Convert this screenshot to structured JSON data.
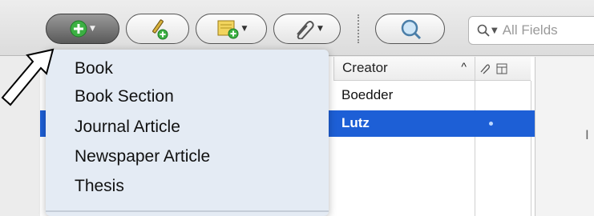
{
  "toolbar": {
    "buttons": [
      {
        "name": "new-item",
        "icon": "green-plus-icon"
      },
      {
        "name": "add-by-identifier",
        "icon": "magic-wand-icon"
      },
      {
        "name": "new-note",
        "icon": "note-icon"
      },
      {
        "name": "add-attachment",
        "icon": "paperclip-icon"
      },
      {
        "name": "advanced-search",
        "icon": "magnifier-icon"
      }
    ],
    "search_placeholder": "All Fields"
  },
  "menu": {
    "items": [
      "Book",
      "Book Section",
      "Journal Article",
      "Newspaper Article",
      "Thesis"
    ]
  },
  "table": {
    "columns": {
      "creator": "Creator",
      "sort_indicator": "^"
    },
    "rows": [
      {
        "creator": "Boedder",
        "selected": false
      },
      {
        "creator": "Lutz",
        "selected": true
      }
    ]
  },
  "right_pane": {
    "text": "I"
  },
  "colors": {
    "selection": "#1d5fd6",
    "menu_bg": "#e4ebf4",
    "plus_green": "#3cb043"
  }
}
